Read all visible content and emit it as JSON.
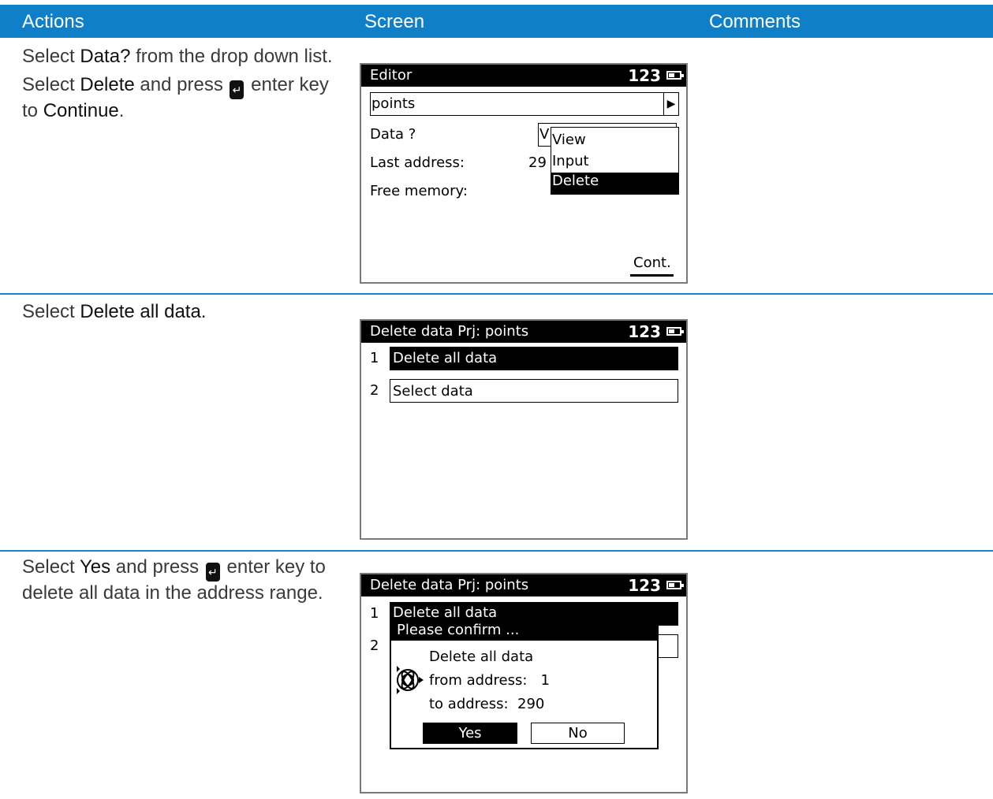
{
  "header": {
    "actions": "Actions",
    "screen": "Screen",
    "comments": "Comments"
  },
  "row1": {
    "line1_a": "Select ",
    "line1_b": "Data?",
    "line1_c": " from the drop down list.",
    "line2_a": "Select ",
    "line2_b": "Delete",
    "line2_c": " and press ",
    "line2_d": " enter key to ",
    "line2_e": "Continue",
    "line2_f": ".",
    "screen": {
      "title": "Editor",
      "status": "123",
      "project": "points",
      "arrow": "▶",
      "data_label": "Data ?",
      "data_value": "V",
      "last_label": "Last address:",
      "last_value": "29",
      "free_label": "Free memory:",
      "menu": [
        "View",
        "Input",
        "Delete"
      ],
      "softkey": "Cont."
    }
  },
  "row2": {
    "a": "Select ",
    "b": "Delete all data.",
    "screen": {
      "title": "Delete data  Prj: points",
      "status": "123",
      "items": [
        {
          "num": "1",
          "label": "Delete all data"
        },
        {
          "num": "2",
          "label": "Select data"
        }
      ]
    }
  },
  "row3": {
    "a": "Select ",
    "b": "Yes",
    "c": " and press ",
    "d": " enter key to delete all data in the address range.",
    "screen": {
      "title": "Delete data  Prj: points",
      "status": "123",
      "num1": "1",
      "item1": "Delete all data",
      "num2": "2",
      "dialog": {
        "title": "Please confirm ...",
        "line1": "Delete all data",
        "line2": "from address:   1",
        "line3": "to address:  290",
        "yes": "Yes",
        "no": "No"
      }
    }
  },
  "icons": {
    "enter": "enter-key-icon",
    "battery": "battery-icon",
    "trimble": "trimble-logo-icon"
  }
}
